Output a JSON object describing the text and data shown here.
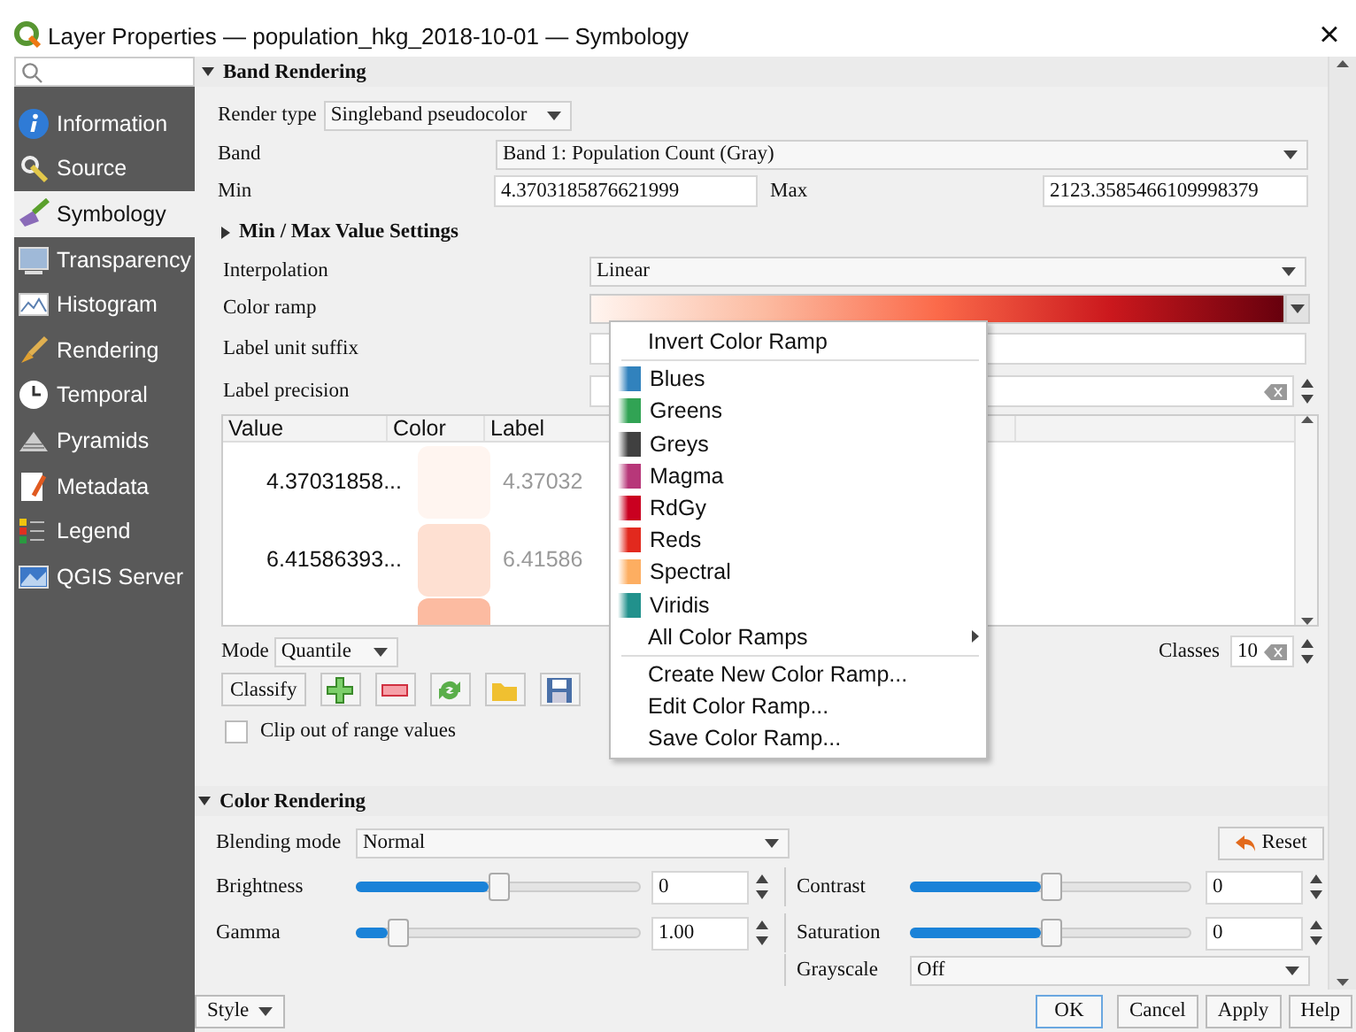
{
  "window": {
    "title": "Layer Properties — population_hkg_2018-10-01 — Symbology",
    "close": "×"
  },
  "sidebar": {
    "items": [
      {
        "label": "Information",
        "selected": false
      },
      {
        "label": "Source",
        "selected": false
      },
      {
        "label": "Symbology",
        "selected": true
      },
      {
        "label": "Transparency",
        "selected": false
      },
      {
        "label": "Histogram",
        "selected": false
      },
      {
        "label": "Rendering",
        "selected": false
      },
      {
        "label": "Temporal",
        "selected": false
      },
      {
        "label": "Pyramids",
        "selected": false
      },
      {
        "label": "Metadata",
        "selected": false
      },
      {
        "label": "Legend",
        "selected": false
      },
      {
        "label": "QGIS Server",
        "selected": false
      }
    ]
  },
  "band_rendering": {
    "header": "Band Rendering",
    "expanded": true,
    "render_type": {
      "label": "Render type",
      "value": "Singleband pseudocolor"
    },
    "band": {
      "label": "Band",
      "value": "Band 1: Population Count (Gray)"
    },
    "min": {
      "label": "Min",
      "value": "4.3703185876621999"
    },
    "max": {
      "label": "Max",
      "value": "2123.3585466109998379"
    },
    "minmax_settings": {
      "label": "Min / Max Value Settings",
      "expanded": false
    },
    "interpolation": {
      "label": "Interpolation",
      "value": "Linear"
    },
    "color_ramp": {
      "label": "Color ramp"
    },
    "label_unit_suffix": {
      "label": "Label unit suffix"
    },
    "label_precision": {
      "label": "Label precision"
    },
    "table": {
      "columns": [
        "Value",
        "Color",
        "Label"
      ],
      "rows": [
        {
          "value": "4.37031858...",
          "color": "#fff5f0",
          "label": "4.37032"
        },
        {
          "value": "6.41586393...",
          "color": "#fee0d2",
          "label": "6.41586"
        },
        {
          "color": "#fcbba1"
        }
      ]
    },
    "mode": {
      "label": "Mode",
      "value": "Quantile"
    },
    "classes": {
      "label": "Classes",
      "value": "10"
    },
    "classify": "Classify",
    "clip": {
      "label": "Clip out of range values",
      "checked": false
    }
  },
  "color_ramp_menu": {
    "items": [
      {
        "kind": "action",
        "label": "Invert Color Ramp"
      },
      {
        "kind": "separator"
      },
      {
        "kind": "ramp",
        "label": "Blues",
        "color": "#3182bd"
      },
      {
        "kind": "ramp",
        "label": "Greens",
        "color": "#31a354"
      },
      {
        "kind": "ramp",
        "label": "Greys",
        "color": "#404040"
      },
      {
        "kind": "ramp",
        "label": "Magma",
        "color": "#b73779"
      },
      {
        "kind": "ramp",
        "label": "RdGy",
        "color": "#ca0020"
      },
      {
        "kind": "ramp",
        "label": "Reds",
        "color": "#e2291e"
      },
      {
        "kind": "ramp",
        "label": "Spectral",
        "color": "#fdae61"
      },
      {
        "kind": "ramp",
        "label": "Viridis",
        "color": "#21918c"
      },
      {
        "kind": "submenu",
        "label": "All Color Ramps"
      },
      {
        "kind": "separator"
      },
      {
        "kind": "action",
        "label": "Create New Color Ramp..."
      },
      {
        "kind": "action",
        "label": "Edit Color Ramp..."
      },
      {
        "kind": "action",
        "label": "Save Color Ramp..."
      }
    ]
  },
  "color_rendering": {
    "header": "Color Rendering",
    "expanded": true,
    "blending_mode": {
      "label": "Blending mode",
      "value": "Normal"
    },
    "reset": "Reset",
    "brightness": {
      "label": "Brightness",
      "level": 0.5,
      "value": "0"
    },
    "contrast": {
      "label": "Contrast",
      "level": 0.5,
      "value": "0"
    },
    "gamma": {
      "label": "Gamma",
      "level": 0.12,
      "value": "1.00"
    },
    "saturation": {
      "label": "Saturation",
      "level": 0.5,
      "value": "0"
    },
    "grayscale": {
      "label": "Grayscale",
      "value": "Off"
    }
  },
  "footer": {
    "style": "Style",
    "buttons": [
      "OK",
      "Cancel",
      "Apply",
      "Help"
    ]
  }
}
